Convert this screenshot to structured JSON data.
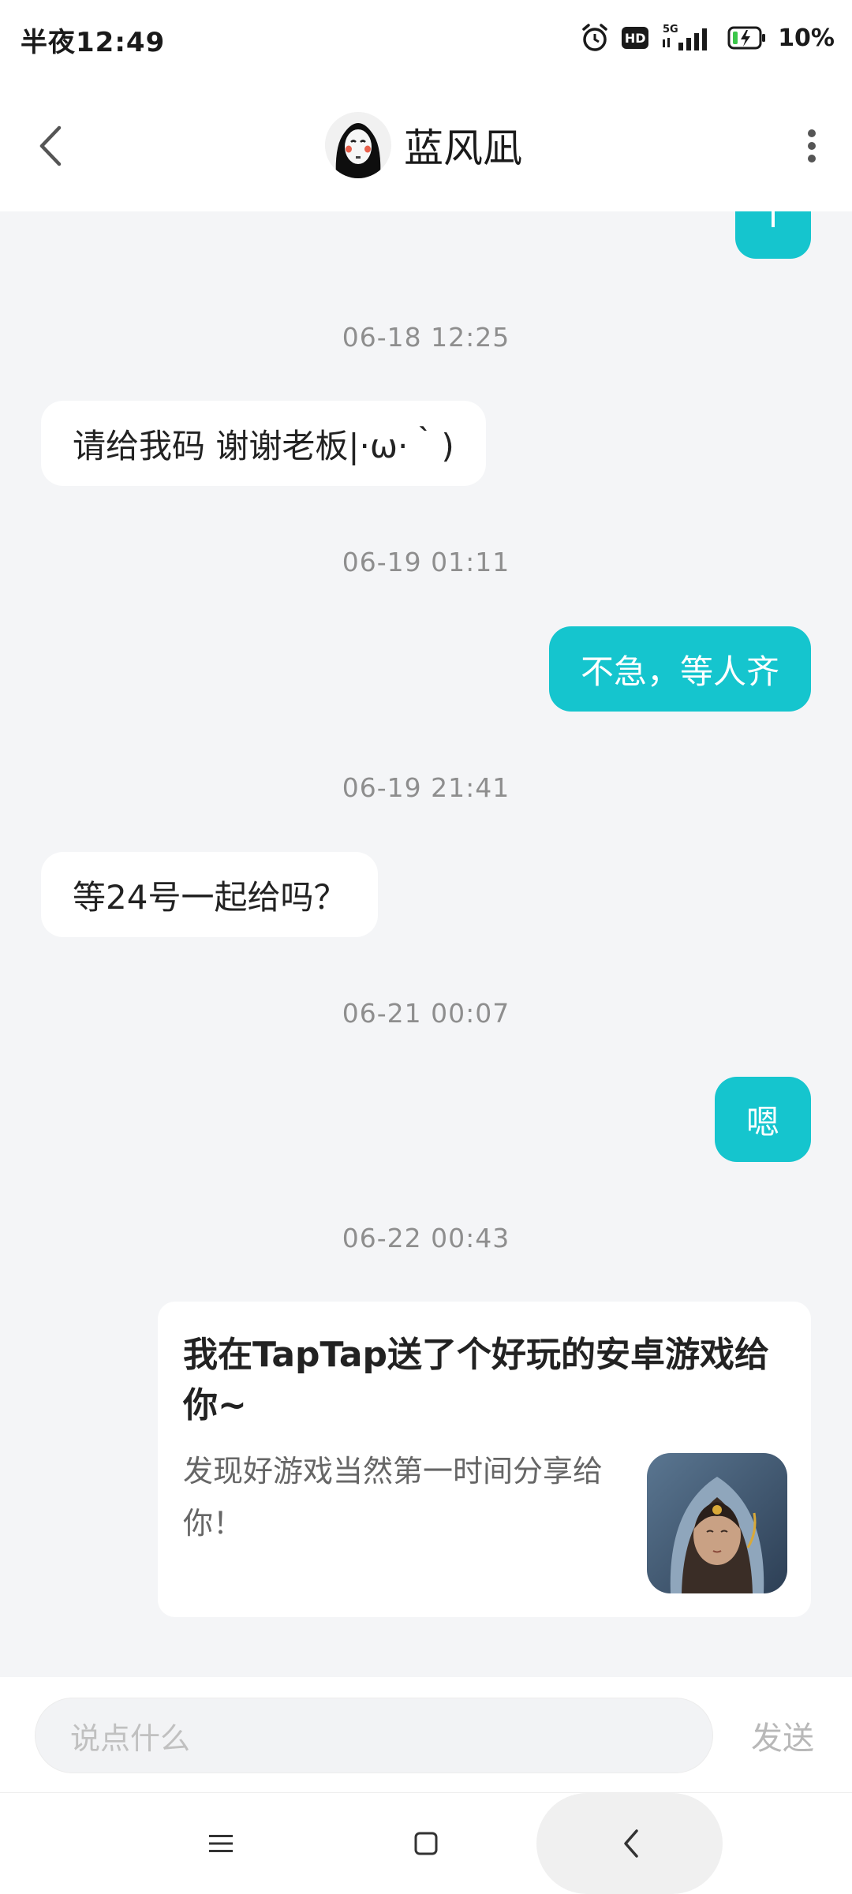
{
  "status_bar": {
    "time": "半夜12:49",
    "network": "5G",
    "battery": "10%"
  },
  "header": {
    "title": "蓝风凪"
  },
  "messages": [
    {
      "type": "timestamp",
      "text": "06-18 12:25"
    },
    {
      "type": "incoming",
      "text": "请给我码 谢谢老板|·ω·｀)"
    },
    {
      "type": "timestamp",
      "text": "06-19 01:11"
    },
    {
      "type": "outgoing",
      "text": "不急，等人齐"
    },
    {
      "type": "timestamp",
      "text": "06-19 21:41"
    },
    {
      "type": "incoming",
      "text": "等24号一起给吗？"
    },
    {
      "type": "timestamp",
      "text": "06-21 00:07"
    },
    {
      "type": "outgoing",
      "text": "嗯"
    },
    {
      "type": "timestamp",
      "text": "06-22 00:43"
    }
  ],
  "share_card": {
    "title": "我在TapTap送了个好玩的安卓游戏给你~",
    "description": "发现好游戏当然第一时间分享给你！"
  },
  "composer": {
    "placeholder": "说点什么",
    "send_label": "发送"
  },
  "colors": {
    "accent": "#15c5ce",
    "chat_bg": "#f4f5f7"
  }
}
